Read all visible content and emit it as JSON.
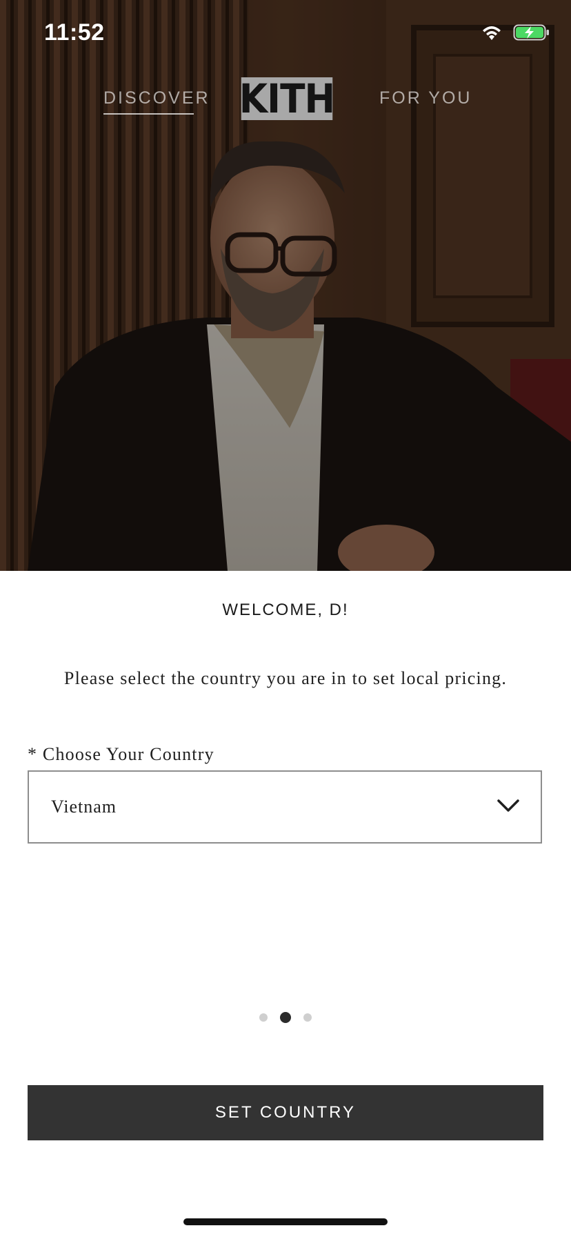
{
  "status_bar": {
    "time": "11:52",
    "icons": [
      "wifi-icon",
      "battery-charging-icon"
    ],
    "battery_color": "#4cd964"
  },
  "nav": {
    "tabs": [
      {
        "label": "DISCOVER",
        "active": true
      },
      {
        "label": "FOR YOU",
        "active": false
      }
    ],
    "logo_text": "KITH"
  },
  "welcome": {
    "title": "WELCOME, D!",
    "instruction": "Please select the country you are in to set local pricing."
  },
  "country_field": {
    "label": "* Choose Your Country",
    "selected": "Vietnam",
    "icon": "chevron-down-icon"
  },
  "pager": {
    "total": 3,
    "active_index": 1
  },
  "actions": {
    "submit_label": "SET COUNTRY"
  },
  "colors": {
    "button_bg": "#333333",
    "logo_bg": "#a8a8a8",
    "active_dot": "#2b2b2b",
    "inactive_dot": "#cfcfcf"
  }
}
